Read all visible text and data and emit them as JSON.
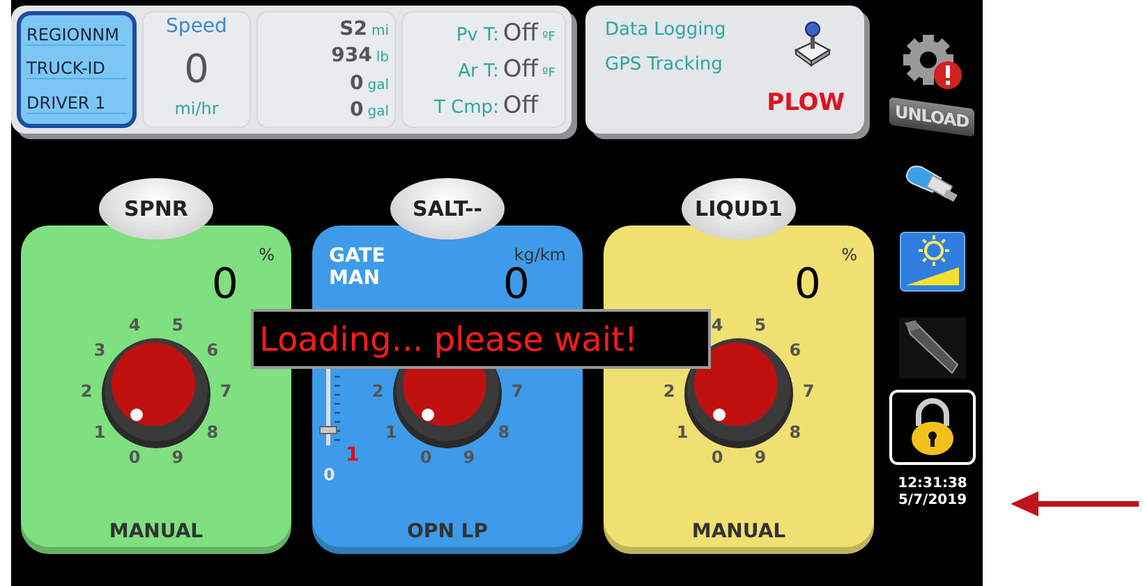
{
  "id_box": {
    "lines": [
      "REGIONNM",
      "TRUCK-ID",
      "DRIVER 1"
    ]
  },
  "speed": {
    "label": "Speed",
    "value": "0",
    "unit": "mi/hr"
  },
  "totals": [
    {
      "value": "S2",
      "unit": "mi"
    },
    {
      "value": "934",
      "unit": "lb"
    },
    {
      "value": "0",
      "unit": "gal"
    },
    {
      "value": "0",
      "unit": "gal"
    }
  ],
  "temps": [
    {
      "label": "Pv T:",
      "value": "Off",
      "unit": "ºF"
    },
    {
      "label": "Ar T:",
      "value": "Off",
      "unit": "ºF"
    },
    {
      "label": "T Cmp:",
      "value": "Off"
    }
  ],
  "status": {
    "items": [
      "Data Logging",
      "GPS Tracking"
    ],
    "mode": "PLOW"
  },
  "sidebar": {
    "unload_label": "UNLOAD",
    "time": "12:31:38",
    "date": "5/7/2019"
  },
  "channels": [
    {
      "kind": "plain",
      "name": "SPNR",
      "color": "#7fe07f",
      "unit": "%",
      "value": "0",
      "mode": "MANUAL",
      "scale_start": [
        "0",
        "1",
        "2",
        "3",
        "4",
        "5",
        "6",
        "7",
        "8",
        "9"
      ]
    },
    {
      "kind": "gate",
      "name": "SALT--",
      "color": "#3d9be9",
      "gate_label": "GATE",
      "gate_mode": "MAN",
      "unit": "kg/km",
      "value": "0",
      "mode": "OPN LP",
      "gate": {
        "level": 0.12,
        "setting": "1",
        "minimum": "0"
      },
      "scale_start": [
        "0",
        "1",
        "2"
      ],
      "scale_end": [
        "7",
        "8",
        "9"
      ]
    },
    {
      "kind": "plain",
      "name": "LIQUD1",
      "color": "#f0e071",
      "unit": "%",
      "value": "0",
      "mode": "MANUAL",
      "scale_start": [
        "0",
        "1",
        "2"
      ],
      "scale_end": [
        "4",
        "5",
        "6",
        "7",
        "8",
        "9"
      ]
    }
  ],
  "overlay": {
    "message": "Loading... please wait!"
  }
}
